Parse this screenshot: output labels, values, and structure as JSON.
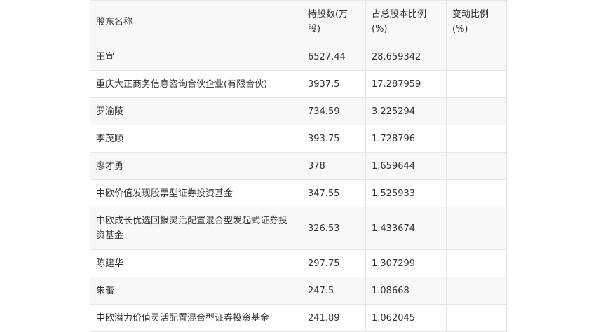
{
  "table": {
    "headers": [
      "股东名称",
      "持股数(万股)",
      "占总股本比例(%)",
      "变动比例(%)"
    ],
    "rows": [
      [
        "王宣",
        "6527.44",
        "28.659342",
        ""
      ],
      [
        "重庆大正商务信息咨询合伙企业(有限合伙)",
        "3937.5",
        "17.287959",
        ""
      ],
      [
        "罗渝陵",
        "734.59",
        "3.225294",
        ""
      ],
      [
        "李茂顺",
        "393.75",
        "1.728796",
        ""
      ],
      [
        "廖才勇",
        "378",
        "1.659644",
        ""
      ],
      [
        "中欧价值发现股票型证券投资基金",
        "347.55",
        "1.525933",
        ""
      ],
      [
        "中欧成长优选回报灵活配置混合型发起式证券投资基金",
        "326.53",
        "1.433674",
        ""
      ],
      [
        "陈建华",
        "297.75",
        "1.307299",
        ""
      ],
      [
        "朱蕾",
        "247.5",
        "1.08668",
        ""
      ],
      [
        "中欧潜力价值灵活配置混合型证券投资基金",
        "241.89",
        "1.062045",
        ""
      ]
    ]
  }
}
